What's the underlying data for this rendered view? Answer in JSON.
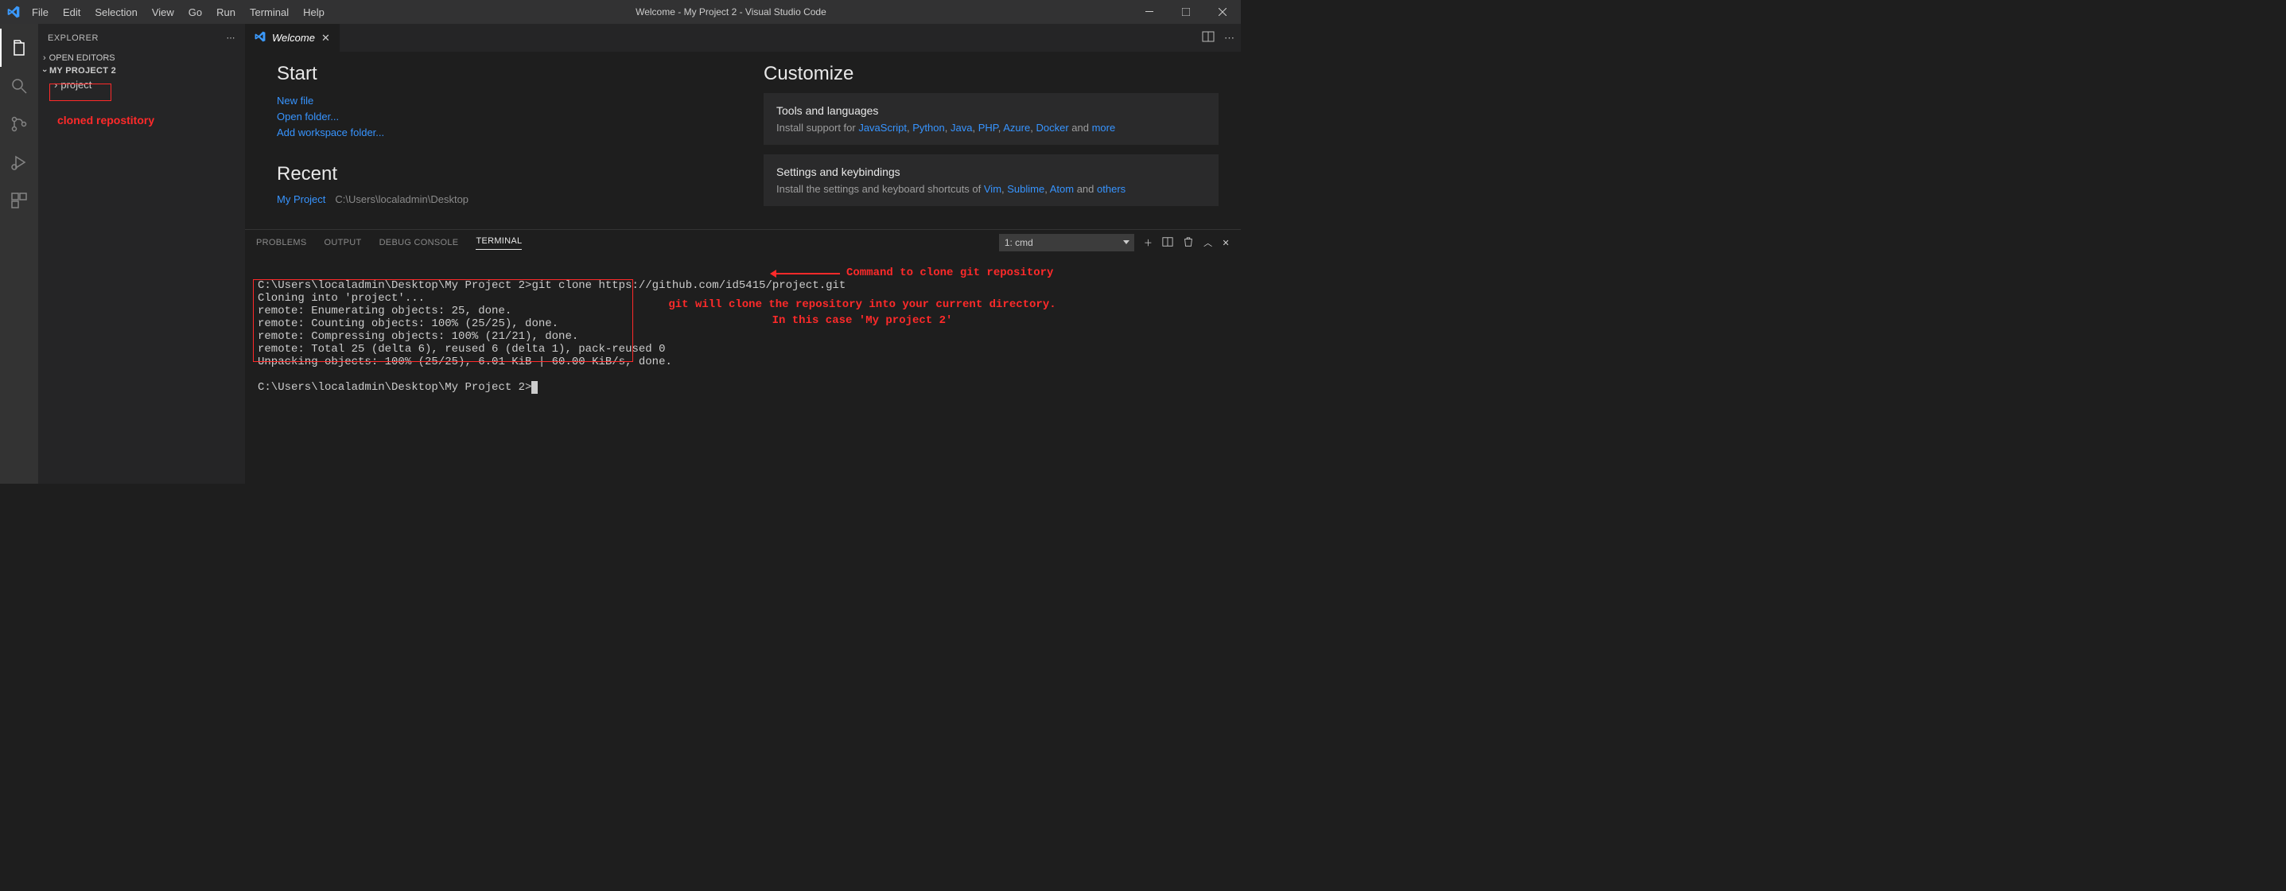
{
  "titlebar": {
    "menus": [
      "File",
      "Edit",
      "Selection",
      "View",
      "Go",
      "Run",
      "Terminal",
      "Help"
    ],
    "title": "Welcome - My Project 2 - Visual Studio Code"
  },
  "sidebar": {
    "header": "EXPLORER",
    "open_editors": "OPEN EDITORS",
    "workspace": "MY PROJECT 2",
    "tree_item": "project"
  },
  "annotations": {
    "cloned_repo": "cloned repostitory",
    "cmd_label": "Command to clone git repository",
    "explain1": "git will clone the repository into your current directory.",
    "explain2": "In this case 'My project 2'"
  },
  "tab": {
    "label": "Welcome"
  },
  "welcome": {
    "start_title": "Start",
    "new_file": "New file",
    "open_folder": "Open folder...",
    "add_workspace": "Add workspace folder...",
    "recent_title": "Recent",
    "recent_name": "My Project",
    "recent_path": "C:\\Users\\localadmin\\Desktop",
    "customize_title": "Customize",
    "tools_card": {
      "title": "Tools and languages",
      "prefix": "Install support for ",
      "links": [
        "JavaScript",
        "Python",
        "Java",
        "PHP",
        "Azure",
        "Docker"
      ],
      "and": " and ",
      "more": "more"
    },
    "settings_card": {
      "title": "Settings and keybindings",
      "prefix": "Install the settings and keyboard shortcuts of ",
      "links": [
        "Vim",
        "Sublime",
        "Atom"
      ],
      "and": " and ",
      "others": "others"
    }
  },
  "panel": {
    "tabs": [
      "PROBLEMS",
      "OUTPUT",
      "DEBUG CONSOLE",
      "TERMINAL"
    ],
    "select": "1: cmd"
  },
  "terminal": {
    "cmd_line": "C:\\Users\\localadmin\\Desktop\\My Project 2>git clone https://github.com/id5415/project.git",
    "out1": "Cloning into 'project'...",
    "out2": "remote: Enumerating objects: 25, done.",
    "out3": "remote: Counting objects: 100% (25/25), done.",
    "out4": "remote: Compressing objects: 100% (21/21), done.",
    "out5": "remote: Total 25 (delta 6), reused 6 (delta 1), pack-reused 0",
    "out6": "Unpacking objects: 100% (25/25), 6.01 KiB | 60.00 KiB/s, done.",
    "prompt2": "C:\\Users\\localadmin\\Desktop\\My Project 2>"
  }
}
